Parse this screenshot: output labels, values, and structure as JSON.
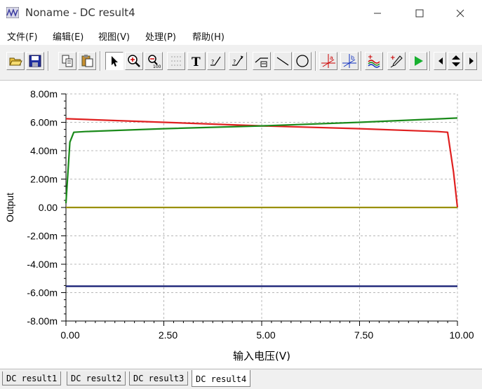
{
  "window": {
    "title": "Noname - DC result4"
  },
  "menu": [
    "文件(F)",
    "编辑(E)",
    "视图(V)",
    "处理(P)",
    "帮助(H)"
  ],
  "toolbar": {
    "buttons": [
      "open-icon",
      "save-icon",
      "copy-icon",
      "paste-icon",
      "pointer-icon",
      "zoom-in-icon",
      "zoom-100-icon",
      "grid-icon",
      "text-icon",
      "annotate-1-icon",
      "annotate-2-icon",
      "annotate-3-icon",
      "line-icon",
      "ellipse-icon",
      "cursor-a-icon",
      "cursor-b-icon",
      "waves-icon",
      "probe-icon",
      "run-icon",
      "scroll-left-icon",
      "scroll-updown-icon",
      "scroll-right-icon"
    ]
  },
  "tabs": [
    "DC result1",
    "DC result2",
    "DC result3",
    "DC result4"
  ],
  "active_tab": 3,
  "chart_data": {
    "type": "line",
    "xlabel": "输入电压(V)",
    "ylabel": "Output",
    "xlim": [
      0,
      10
    ],
    "ylim": [
      -8,
      8
    ],
    "x_ticks": [
      "0.00",
      "2.50",
      "5.00",
      "7.50",
      "10.00"
    ],
    "y_ticks": [
      "8.00m",
      "6.00m",
      "4.00m",
      "2.00m",
      "0.00",
      "-2.00m",
      "-4.00m",
      "-6.00m",
      "-8.00m"
    ],
    "grid": true,
    "series": [
      {
        "color": "#e02020",
        "x": [
          0,
          0.5,
          2.5,
          5.0,
          7.5,
          9.5,
          9.75,
          9.9,
          10.0
        ],
        "y": [
          6.25,
          6.2,
          6.0,
          5.75,
          5.55,
          5.35,
          5.3,
          2.5,
          0.0
        ]
      },
      {
        "color": "#1a8a1a",
        "x": [
          0,
          0.1,
          0.2,
          0.5,
          2.5,
          5.0,
          7.5,
          10.0
        ],
        "y": [
          0.3,
          4.6,
          5.3,
          5.35,
          5.55,
          5.75,
          6.0,
          6.3
        ]
      },
      {
        "color": "#9a9000",
        "x": [
          0,
          10
        ],
        "y": [
          0,
          0
        ]
      },
      {
        "color": "#101870",
        "x": [
          0,
          10
        ],
        "y": [
          -5.55,
          -5.55
        ]
      }
    ]
  }
}
